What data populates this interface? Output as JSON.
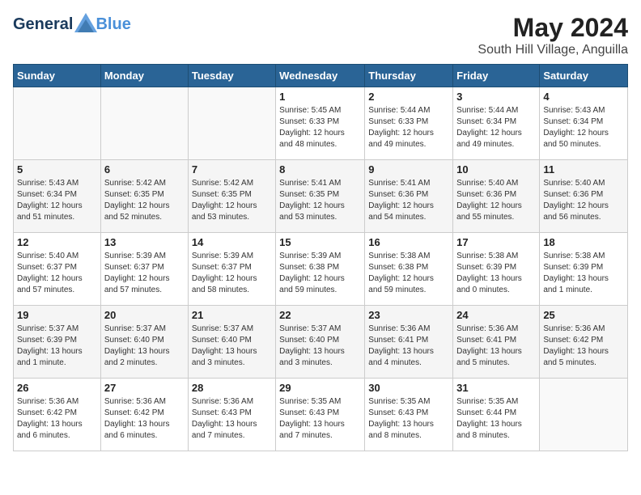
{
  "header": {
    "logo_line1": "General",
    "logo_line2": "Blue",
    "month_year": "May 2024",
    "location": "South Hill Village, Anguilla"
  },
  "days_of_week": [
    "Sunday",
    "Monday",
    "Tuesday",
    "Wednesday",
    "Thursday",
    "Friday",
    "Saturday"
  ],
  "weeks": [
    [
      {
        "day": "",
        "info": ""
      },
      {
        "day": "",
        "info": ""
      },
      {
        "day": "",
        "info": ""
      },
      {
        "day": "1",
        "info": "Sunrise: 5:45 AM\nSunset: 6:33 PM\nDaylight: 12 hours\nand 48 minutes."
      },
      {
        "day": "2",
        "info": "Sunrise: 5:44 AM\nSunset: 6:33 PM\nDaylight: 12 hours\nand 49 minutes."
      },
      {
        "day": "3",
        "info": "Sunrise: 5:44 AM\nSunset: 6:34 PM\nDaylight: 12 hours\nand 49 minutes."
      },
      {
        "day": "4",
        "info": "Sunrise: 5:43 AM\nSunset: 6:34 PM\nDaylight: 12 hours\nand 50 minutes."
      }
    ],
    [
      {
        "day": "5",
        "info": "Sunrise: 5:43 AM\nSunset: 6:34 PM\nDaylight: 12 hours\nand 51 minutes."
      },
      {
        "day": "6",
        "info": "Sunrise: 5:42 AM\nSunset: 6:35 PM\nDaylight: 12 hours\nand 52 minutes."
      },
      {
        "day": "7",
        "info": "Sunrise: 5:42 AM\nSunset: 6:35 PM\nDaylight: 12 hours\nand 53 minutes."
      },
      {
        "day": "8",
        "info": "Sunrise: 5:41 AM\nSunset: 6:35 PM\nDaylight: 12 hours\nand 53 minutes."
      },
      {
        "day": "9",
        "info": "Sunrise: 5:41 AM\nSunset: 6:36 PM\nDaylight: 12 hours\nand 54 minutes."
      },
      {
        "day": "10",
        "info": "Sunrise: 5:40 AM\nSunset: 6:36 PM\nDaylight: 12 hours\nand 55 minutes."
      },
      {
        "day": "11",
        "info": "Sunrise: 5:40 AM\nSunset: 6:36 PM\nDaylight: 12 hours\nand 56 minutes."
      }
    ],
    [
      {
        "day": "12",
        "info": "Sunrise: 5:40 AM\nSunset: 6:37 PM\nDaylight: 12 hours\nand 57 minutes."
      },
      {
        "day": "13",
        "info": "Sunrise: 5:39 AM\nSunset: 6:37 PM\nDaylight: 12 hours\nand 57 minutes."
      },
      {
        "day": "14",
        "info": "Sunrise: 5:39 AM\nSunset: 6:37 PM\nDaylight: 12 hours\nand 58 minutes."
      },
      {
        "day": "15",
        "info": "Sunrise: 5:39 AM\nSunset: 6:38 PM\nDaylight: 12 hours\nand 59 minutes."
      },
      {
        "day": "16",
        "info": "Sunrise: 5:38 AM\nSunset: 6:38 PM\nDaylight: 12 hours\nand 59 minutes."
      },
      {
        "day": "17",
        "info": "Sunrise: 5:38 AM\nSunset: 6:39 PM\nDaylight: 13 hours\nand 0 minutes."
      },
      {
        "day": "18",
        "info": "Sunrise: 5:38 AM\nSunset: 6:39 PM\nDaylight: 13 hours\nand 1 minute."
      }
    ],
    [
      {
        "day": "19",
        "info": "Sunrise: 5:37 AM\nSunset: 6:39 PM\nDaylight: 13 hours\nand 1 minute."
      },
      {
        "day": "20",
        "info": "Sunrise: 5:37 AM\nSunset: 6:40 PM\nDaylight: 13 hours\nand 2 minutes."
      },
      {
        "day": "21",
        "info": "Sunrise: 5:37 AM\nSunset: 6:40 PM\nDaylight: 13 hours\nand 3 minutes."
      },
      {
        "day": "22",
        "info": "Sunrise: 5:37 AM\nSunset: 6:40 PM\nDaylight: 13 hours\nand 3 minutes."
      },
      {
        "day": "23",
        "info": "Sunrise: 5:36 AM\nSunset: 6:41 PM\nDaylight: 13 hours\nand 4 minutes."
      },
      {
        "day": "24",
        "info": "Sunrise: 5:36 AM\nSunset: 6:41 PM\nDaylight: 13 hours\nand 5 minutes."
      },
      {
        "day": "25",
        "info": "Sunrise: 5:36 AM\nSunset: 6:42 PM\nDaylight: 13 hours\nand 5 minutes."
      }
    ],
    [
      {
        "day": "26",
        "info": "Sunrise: 5:36 AM\nSunset: 6:42 PM\nDaylight: 13 hours\nand 6 minutes."
      },
      {
        "day": "27",
        "info": "Sunrise: 5:36 AM\nSunset: 6:42 PM\nDaylight: 13 hours\nand 6 minutes."
      },
      {
        "day": "28",
        "info": "Sunrise: 5:36 AM\nSunset: 6:43 PM\nDaylight: 13 hours\nand 7 minutes."
      },
      {
        "day": "29",
        "info": "Sunrise: 5:35 AM\nSunset: 6:43 PM\nDaylight: 13 hours\nand 7 minutes."
      },
      {
        "day": "30",
        "info": "Sunrise: 5:35 AM\nSunset: 6:43 PM\nDaylight: 13 hours\nand 8 minutes."
      },
      {
        "day": "31",
        "info": "Sunrise: 5:35 AM\nSunset: 6:44 PM\nDaylight: 13 hours\nand 8 minutes."
      },
      {
        "day": "",
        "info": ""
      }
    ]
  ]
}
